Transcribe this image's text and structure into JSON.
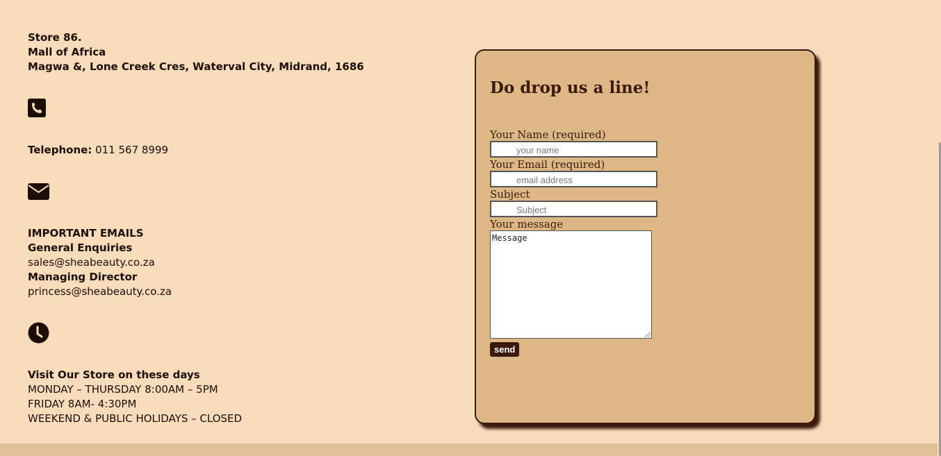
{
  "contact": {
    "address": {
      "line1": "Store 86.",
      "line2": "Mall of Africa",
      "line3": "Magwa &, Lone Creek Cres, Waterval City, Midrand, 1686"
    },
    "telephone": {
      "label": "Telephone:",
      "value": "011 567 8999"
    },
    "emails": {
      "heading": "IMPORTANT EMAILS",
      "general_label": "General Enquiries",
      "general_email": "sales@sheabeauty.co.za",
      "director_label": "Managing Director",
      "director_email": "princess@sheabeauty.co.za"
    },
    "hours": {
      "heading": "Visit Our Store on these days",
      "weekdays": "MONDAY – THURSDAY 8:00AM – 5PM",
      "friday": "FRIDAY 8AM- 4:30PM",
      "weekend": "WEEKEND & PUBLIC HOLIDAYS – CLOSED"
    },
    "icons": {
      "location": "map-pin-icon",
      "phone": "phone-icon",
      "email": "envelope-icon",
      "clock": "clock-icon"
    }
  },
  "form": {
    "title": "Do drop us a line!",
    "name_label": "Your Name (required)",
    "name_placeholder": "your name",
    "email_label": "Your Email (required)",
    "email_placeholder": "email address",
    "subject_label": "Subject",
    "subject_placeholder": "Subject",
    "message_label": "Your message",
    "message_placeholder": "Message",
    "send_label": "send"
  },
  "colors": {
    "page_background": "#f7dcbc",
    "card_background": "#ddb786",
    "accent_dark_brown": "#3a1a0c"
  }
}
